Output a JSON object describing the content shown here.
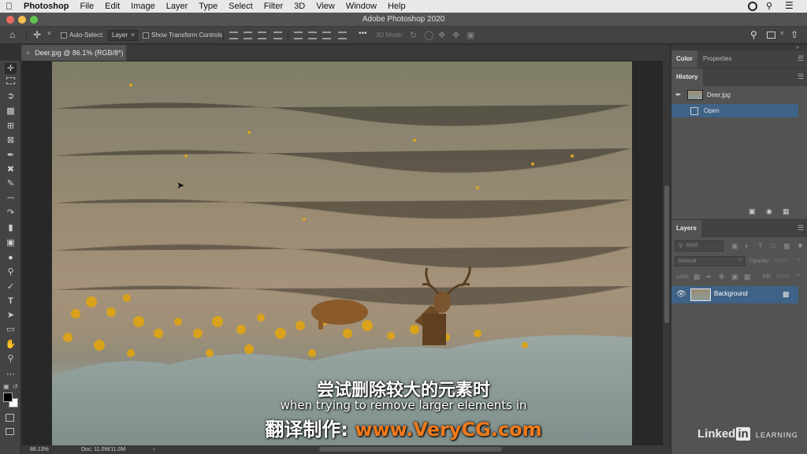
{
  "menubar": {
    "apple": "",
    "app": "Photoshop",
    "items": [
      "File",
      "Edit",
      "Image",
      "Layer",
      "Type",
      "Select",
      "Filter",
      "3D",
      "View",
      "Window",
      "Help"
    ]
  },
  "window": {
    "title": "Adobe Photoshop 2020"
  },
  "options_bar": {
    "auto_select_label": "Auto-Select:",
    "auto_select_value": "Layer",
    "show_transform_label": "Show Transform Controls",
    "more": "•••",
    "mode_3d_label": "3D Mode:"
  },
  "document": {
    "tab_label": "Deer.jpg @ 86.1% (RGB/8*)",
    "close": "×"
  },
  "status": {
    "zoom": "86.13%",
    "doc_info": "Doc: 11.0M/11.0M",
    "arrow": "›"
  },
  "panels": {
    "color_tabs": [
      "Color",
      "Properties"
    ],
    "history_tab": "History",
    "history_items": [
      "Deer.jpg",
      "Open"
    ],
    "layers_tab": "Layers",
    "kind_placeholder": "Kind",
    "blend_mode": "Normal",
    "opacity_label": "Opacity:",
    "opacity_value": "100%",
    "lock_label": "Lock:",
    "fill_label": "Fill:",
    "fill_value": "100%",
    "layer_name": "Background"
  },
  "subtitles": {
    "chinese": "尝试删除较大的元素时",
    "english": "when trying to remove larger elements in",
    "credit_prefix": "翻译制作: ",
    "credit_site": "www.VeryCG.com"
  },
  "watermark": {
    "brand_a": "Linked",
    "brand_b": "in",
    "suffix": "LEARNING"
  },
  "colors": {
    "accent_orange": "#f07a1a",
    "selected_row": "#3f6287",
    "linkedin_blue": "#0a66c2"
  }
}
